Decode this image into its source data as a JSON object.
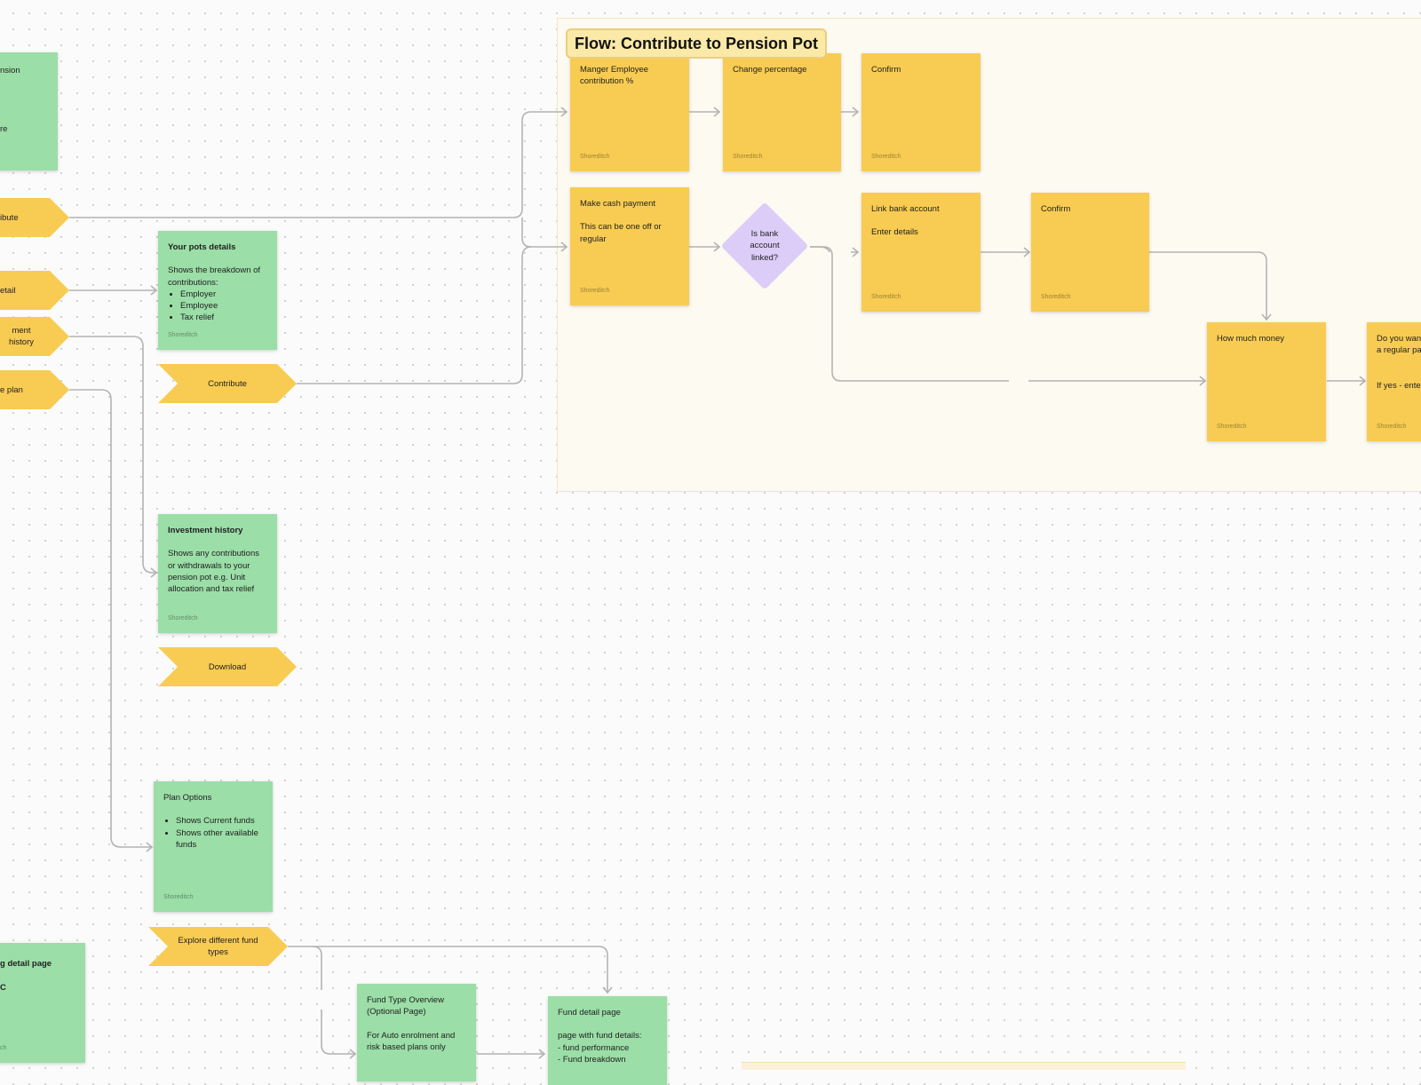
{
  "canvas": {
    "section": {
      "title": "Flow: Contribute to Pension Pot"
    },
    "colors": {
      "green_sticky": "#9bdea7",
      "yellow_sticky": "#f8cc52",
      "decision": "#dccdf8",
      "section_bg": "#fdfaf1",
      "connector": "#b3b3b3"
    },
    "left_column": {
      "cut_sticky": {
        "line1": "nsion",
        "line2": "re"
      },
      "chevrons": [
        {
          "label": "ibute"
        },
        {
          "label": "etail"
        },
        {
          "label": "ment history"
        },
        {
          "label": "e plan"
        }
      ],
      "cut_bottom_sticky": {
        "title": "g detail page",
        "body": "C",
        "author": "ch"
      }
    },
    "stickies": {
      "pots_details": {
        "title": "Your pots details",
        "body": "Shows the breakdown of contributions:",
        "items": [
          "Employer",
          "Employee",
          "Tax relief"
        ],
        "author": "Shoreditch"
      },
      "investment_history": {
        "title": "Investment history",
        "body": "Shows any contributions or withdrawals to your pension pot e.g. Unit allocation and tax relief",
        "author": "Shoreditch"
      },
      "plan_options": {
        "title": "Plan Options",
        "items": [
          "Shows Current funds",
          "Shows other available funds"
        ],
        "author": "Shoreditch"
      },
      "fund_type_overview": {
        "title": "Fund Type Overview\n(Optional Page)",
        "body": "For Auto enrolment and risk based plans only"
      },
      "fund_detail": {
        "title": "Fund detail page",
        "body": "page with fund details:\n- fund performance\n- Fund breakdown"
      },
      "manage_employee": {
        "title": "Manger Employee contribution %",
        "author": "Shoreditch"
      },
      "change_percentage": {
        "title": "Change percentage",
        "author": "Shoreditch"
      },
      "confirm_1": {
        "title": "Confirm",
        "author": "Shoreditch"
      },
      "make_cash_payment": {
        "title": "Make cash payment",
        "body": "This can be one off or regular",
        "author": "Shoreditch"
      },
      "link_bank": {
        "title": "Link bank account",
        "body": "Enter details",
        "author": "Shoreditch"
      },
      "confirm_2": {
        "title": "Confirm",
        "author": "Shoreditch"
      },
      "how_much_money": {
        "title": "How much money",
        "author": "Shoreditch"
      },
      "regular_payment": {
        "title": "Do you want\na regular pa",
        "body": "If yes - ente",
        "author": "Shoreditch"
      }
    },
    "decision": {
      "label": "Is bank\naccount\nlinked?"
    },
    "buttons": {
      "contribute": "Contribute",
      "download": "Download",
      "explore_funds": "Explore different fund types"
    }
  }
}
